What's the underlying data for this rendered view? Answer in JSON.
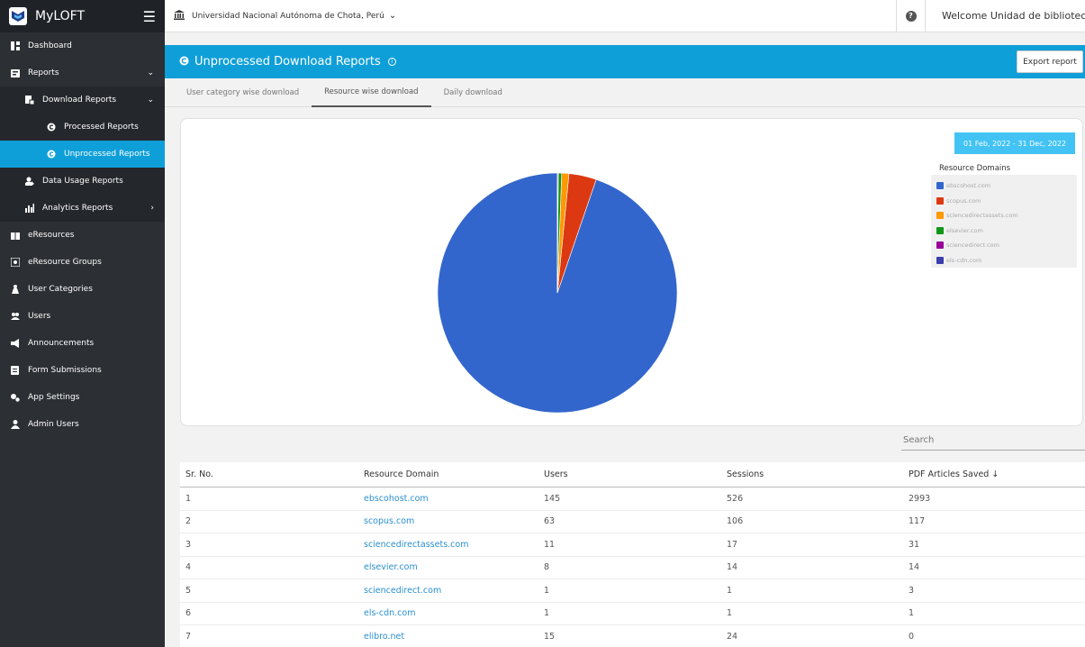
{
  "app": {
    "name": "MyLOFT"
  },
  "sidebar": {
    "items": [
      {
        "label": "Dashboard",
        "icon": "dashboard-icon"
      },
      {
        "label": "Reports",
        "icon": "reports-icon"
      },
      {
        "label": "Download Reports",
        "icon": "download-icon"
      },
      {
        "label": "Processed Reports",
        "icon": "copyright-icon"
      },
      {
        "label": "Unprocessed Reports",
        "icon": "copyright-icon"
      },
      {
        "label": "Data Usage Reports",
        "icon": "data-usage-icon"
      },
      {
        "label": "Analytics Reports",
        "icon": "analytics-icon"
      },
      {
        "label": "eResources",
        "icon": "book-icon"
      },
      {
        "label": "eResource Groups",
        "icon": "group-icon"
      },
      {
        "label": "User Categories",
        "icon": "user-categories-icon"
      },
      {
        "label": "Users",
        "icon": "users-icon"
      },
      {
        "label": "Announcements",
        "icon": "megaphone-icon"
      },
      {
        "label": "Form Submissions",
        "icon": "form-icon"
      },
      {
        "label": "App Settings",
        "icon": "settings-icon"
      },
      {
        "label": "Admin Users",
        "icon": "admin-icon"
      }
    ]
  },
  "topbar": {
    "institution": "Universidad Nacional Autónoma de Chota, Perú",
    "welcome": "Welcome Unidad de biblioteca"
  },
  "header": {
    "title": "Unprocessed Download Reports",
    "export_label": "Export report"
  },
  "tabs": [
    {
      "label": "User category wise download"
    },
    {
      "label": "Resource wise download"
    },
    {
      "label": "Daily download"
    }
  ],
  "chart": {
    "date_range": "01 Feb, 2022 - 31 Dec, 2022",
    "legend_title": "Resource Domains",
    "colors": [
      "#3366cc",
      "#dc3912",
      "#ff9900",
      "#109618",
      "#990099",
      "#3b3eac"
    ]
  },
  "chart_data": {
    "type": "pie",
    "categories": [
      "ebscohost.com",
      "scopus.com",
      "sciencedirectassets.com",
      "elsevier.com",
      "sciencedirect.com",
      "els-cdn.com"
    ],
    "values": [
      2993,
      117,
      31,
      14,
      3,
      1
    ]
  },
  "search": {
    "placeholder": "Search"
  },
  "table": {
    "headers": [
      "Sr. No.",
      "Resource Domain",
      "Users",
      "Sessions",
      "PDF Articles Saved ↓"
    ],
    "rows": [
      [
        "1",
        "ebscohost.com",
        "145",
        "526",
        "2993"
      ],
      [
        "2",
        "scopus.com",
        "63",
        "106",
        "117"
      ],
      [
        "3",
        "sciencedirectassets.com",
        "11",
        "17",
        "31"
      ],
      [
        "4",
        "elsevier.com",
        "8",
        "14",
        "14"
      ],
      [
        "5",
        "sciencedirect.com",
        "1",
        "1",
        "3"
      ],
      [
        "6",
        "els-cdn.com",
        "1",
        "1",
        "1"
      ],
      [
        "7",
        "elibro.net",
        "15",
        "24",
        "0"
      ]
    ]
  }
}
